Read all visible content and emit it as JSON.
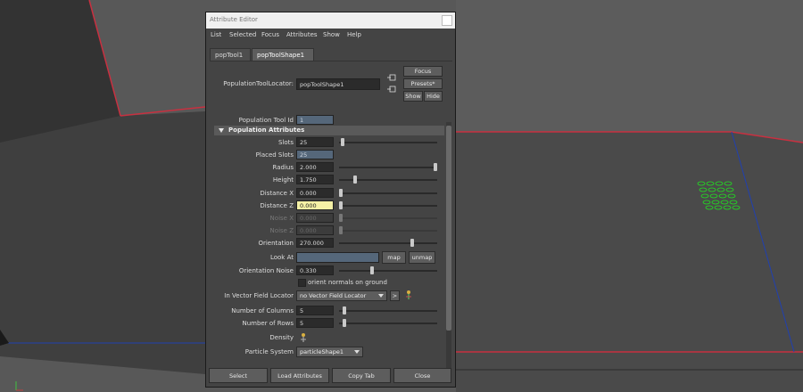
{
  "window": {
    "title": "Attribute Editor",
    "menu": [
      "List",
      "Selected",
      "Focus",
      "Attributes",
      "Show",
      "Help"
    ],
    "tabs": [
      "popTool1",
      "popToolShape1"
    ],
    "active_tab": "popToolShape1"
  },
  "header": {
    "locator_label": "PopulationToolLocator:",
    "locator_value": "popToolShape1",
    "focus_button": "Focus",
    "presets_button": "Presets*",
    "show_button": "Show",
    "hide_button": "Hide"
  },
  "attributes": {
    "tool_id_label": "Population Tool Id",
    "tool_id_value": "1",
    "section_title": "Population Attributes",
    "slots_label": "Slots",
    "slots_value": "25",
    "slots_level": 0.02,
    "placed_label": "Placed Slots",
    "placed_value": "25",
    "radius_label": "Radius",
    "radius_value": "2.000",
    "radius_level": 1.0,
    "height_label": "Height",
    "height_value": "1.750",
    "height_level": 0.15,
    "distx_label": "Distance X",
    "distx_value": "0.000",
    "distx_level": 0.0,
    "distz_label": "Distance Z",
    "distz_value": "0.000",
    "distz_level": 0.0,
    "noisex_label": "Noise X",
    "noisex_value": "0.000",
    "noisex_level": 0.0,
    "noisez_label": "Noise Z",
    "noisez_value": "0.000",
    "noisez_level": 0.0,
    "orient_label": "Orientation",
    "orient_value": "270.000",
    "orient_level": 0.75,
    "lookat_label": "Look At",
    "lookat_value": "",
    "map_button": "map",
    "unmap_button": "unmap",
    "onoise_label": "Orientation Noise",
    "onoise_value": "0.330",
    "onoise_level": 0.33,
    "orient_normals_label": "orient normals on ground",
    "vfl_label": "In Vector Field Locator",
    "vfl_value": "no Vector Field Locator",
    "vfl_go": ">",
    "cols_label": "Number of Columns",
    "cols_value": "5",
    "cols_level": 0.04,
    "rows_label": "Number of Rows",
    "rows_value": "5",
    "rows_level": 0.04,
    "density_label": "Density",
    "particle_label": "Particle System",
    "particle_value": "particleShape1"
  },
  "footer": {
    "select": "Select",
    "load": "Load Attributes",
    "copy": "Copy Tab",
    "close": "Close"
  },
  "icons": [
    "select-node-icon",
    "remove-node-icon",
    "paint-brush-icon",
    "density-paint-icon"
  ],
  "colors": {
    "viewport_bg": "#585858",
    "grid_line": "#c83040",
    "axis_line": "#2040b0",
    "selection_green": "#20e020",
    "highlight_field": "#f5f1a6"
  }
}
